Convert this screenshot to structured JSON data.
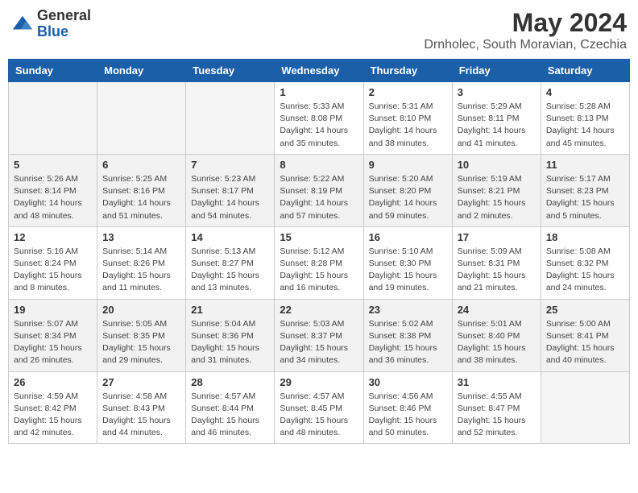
{
  "logo": {
    "general": "General",
    "blue": "Blue"
  },
  "title": {
    "month_year": "May 2024",
    "location": "Drnholec, South Moravian, Czechia"
  },
  "weekdays": [
    "Sunday",
    "Monday",
    "Tuesday",
    "Wednesday",
    "Thursday",
    "Friday",
    "Saturday"
  ],
  "weeks": [
    [
      {
        "day": "",
        "info": ""
      },
      {
        "day": "",
        "info": ""
      },
      {
        "day": "",
        "info": ""
      },
      {
        "day": "1",
        "info": "Sunrise: 5:33 AM\nSunset: 8:08 PM\nDaylight: 14 hours and 35 minutes."
      },
      {
        "day": "2",
        "info": "Sunrise: 5:31 AM\nSunset: 8:10 PM\nDaylight: 14 hours and 38 minutes."
      },
      {
        "day": "3",
        "info": "Sunrise: 5:29 AM\nSunset: 8:11 PM\nDaylight: 14 hours and 41 minutes."
      },
      {
        "day": "4",
        "info": "Sunrise: 5:28 AM\nSunset: 8:13 PM\nDaylight: 14 hours and 45 minutes."
      }
    ],
    [
      {
        "day": "5",
        "info": "Sunrise: 5:26 AM\nSunset: 8:14 PM\nDaylight: 14 hours and 48 minutes."
      },
      {
        "day": "6",
        "info": "Sunrise: 5:25 AM\nSunset: 8:16 PM\nDaylight: 14 hours and 51 minutes."
      },
      {
        "day": "7",
        "info": "Sunrise: 5:23 AM\nSunset: 8:17 PM\nDaylight: 14 hours and 54 minutes."
      },
      {
        "day": "8",
        "info": "Sunrise: 5:22 AM\nSunset: 8:19 PM\nDaylight: 14 hours and 57 minutes."
      },
      {
        "day": "9",
        "info": "Sunrise: 5:20 AM\nSunset: 8:20 PM\nDaylight: 14 hours and 59 minutes."
      },
      {
        "day": "10",
        "info": "Sunrise: 5:19 AM\nSunset: 8:21 PM\nDaylight: 15 hours and 2 minutes."
      },
      {
        "day": "11",
        "info": "Sunrise: 5:17 AM\nSunset: 8:23 PM\nDaylight: 15 hours and 5 minutes."
      }
    ],
    [
      {
        "day": "12",
        "info": "Sunrise: 5:16 AM\nSunset: 8:24 PM\nDaylight: 15 hours and 8 minutes."
      },
      {
        "day": "13",
        "info": "Sunrise: 5:14 AM\nSunset: 8:26 PM\nDaylight: 15 hours and 11 minutes."
      },
      {
        "day": "14",
        "info": "Sunrise: 5:13 AM\nSunset: 8:27 PM\nDaylight: 15 hours and 13 minutes."
      },
      {
        "day": "15",
        "info": "Sunrise: 5:12 AM\nSunset: 8:28 PM\nDaylight: 15 hours and 16 minutes."
      },
      {
        "day": "16",
        "info": "Sunrise: 5:10 AM\nSunset: 8:30 PM\nDaylight: 15 hours and 19 minutes."
      },
      {
        "day": "17",
        "info": "Sunrise: 5:09 AM\nSunset: 8:31 PM\nDaylight: 15 hours and 21 minutes."
      },
      {
        "day": "18",
        "info": "Sunrise: 5:08 AM\nSunset: 8:32 PM\nDaylight: 15 hours and 24 minutes."
      }
    ],
    [
      {
        "day": "19",
        "info": "Sunrise: 5:07 AM\nSunset: 8:34 PM\nDaylight: 15 hours and 26 minutes."
      },
      {
        "day": "20",
        "info": "Sunrise: 5:05 AM\nSunset: 8:35 PM\nDaylight: 15 hours and 29 minutes."
      },
      {
        "day": "21",
        "info": "Sunrise: 5:04 AM\nSunset: 8:36 PM\nDaylight: 15 hours and 31 minutes."
      },
      {
        "day": "22",
        "info": "Sunrise: 5:03 AM\nSunset: 8:37 PM\nDaylight: 15 hours and 34 minutes."
      },
      {
        "day": "23",
        "info": "Sunrise: 5:02 AM\nSunset: 8:38 PM\nDaylight: 15 hours and 36 minutes."
      },
      {
        "day": "24",
        "info": "Sunrise: 5:01 AM\nSunset: 8:40 PM\nDaylight: 15 hours and 38 minutes."
      },
      {
        "day": "25",
        "info": "Sunrise: 5:00 AM\nSunset: 8:41 PM\nDaylight: 15 hours and 40 minutes."
      }
    ],
    [
      {
        "day": "26",
        "info": "Sunrise: 4:59 AM\nSunset: 8:42 PM\nDaylight: 15 hours and 42 minutes."
      },
      {
        "day": "27",
        "info": "Sunrise: 4:58 AM\nSunset: 8:43 PM\nDaylight: 15 hours and 44 minutes."
      },
      {
        "day": "28",
        "info": "Sunrise: 4:57 AM\nSunset: 8:44 PM\nDaylight: 15 hours and 46 minutes."
      },
      {
        "day": "29",
        "info": "Sunrise: 4:57 AM\nSunset: 8:45 PM\nDaylight: 15 hours and 48 minutes."
      },
      {
        "day": "30",
        "info": "Sunrise: 4:56 AM\nSunset: 8:46 PM\nDaylight: 15 hours and 50 minutes."
      },
      {
        "day": "31",
        "info": "Sunrise: 4:55 AM\nSunset: 8:47 PM\nDaylight: 15 hours and 52 minutes."
      },
      {
        "day": "",
        "info": ""
      }
    ]
  ]
}
